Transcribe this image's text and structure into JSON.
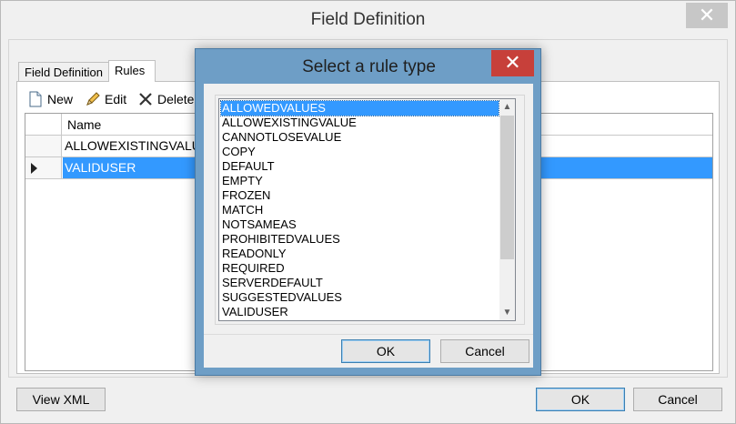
{
  "window": {
    "title": "Field Definition",
    "close_glyph": "✕"
  },
  "tabs": [
    {
      "label": "Field Definition"
    },
    {
      "label": "Rules"
    }
  ],
  "toolbar": {
    "new_label": "New",
    "edit_label": "Edit",
    "delete_label": "Delete"
  },
  "grid": {
    "column_name": "Name",
    "rows": [
      {
        "name": "ALLOWEXISTINGVALUE"
      },
      {
        "name": "VALIDUSER"
      }
    ]
  },
  "buttons": {
    "view_xml": "View XML",
    "ok": "OK",
    "cancel": "Cancel"
  },
  "dialog": {
    "title": "Select a rule type",
    "close_glyph": "✕",
    "ok": "OK",
    "cancel": "Cancel",
    "items": [
      "ALLOWEDVALUES",
      "ALLOWEXISTINGVALUE",
      "CANNOTLOSEVALUE",
      "COPY",
      "DEFAULT",
      "EMPTY",
      "FROZEN",
      "MATCH",
      "NOTSAMEAS",
      "PROHIBITEDVALUES",
      "READONLY",
      "REQUIRED",
      "SERVERDEFAULT",
      "SUGGESTEDVALUES",
      "VALIDUSER"
    ],
    "selected_item": "ALLOWEDVALUES"
  },
  "colors": {
    "selection": "#3399ff",
    "dialog_frame": "#6e9ec6",
    "close_active": "#c7403a"
  }
}
